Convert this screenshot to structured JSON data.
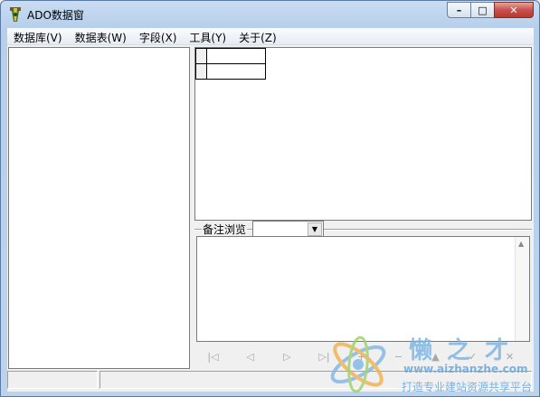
{
  "window": {
    "title": "ADO数据窗",
    "minimize_glyph": "–",
    "maximize_glyph": "□",
    "close_glyph": "✕"
  },
  "menu": {
    "items": [
      {
        "label": "数据库(V)"
      },
      {
        "label": "数据表(W)"
      },
      {
        "label": "字段(X)"
      },
      {
        "label": "工具(Y)"
      },
      {
        "label": "关于(Z)"
      }
    ]
  },
  "memo": {
    "label": "备注浏览",
    "selected_value": "",
    "dropdown_glyph": "▼",
    "scroll_up_glyph": "▲"
  },
  "navigator": {
    "buttons": [
      {
        "name": "first-record",
        "glyph": "|◁"
      },
      {
        "name": "prior-record",
        "glyph": "◁"
      },
      {
        "name": "next-record",
        "glyph": "▷"
      },
      {
        "name": "last-record",
        "glyph": "▷|"
      },
      {
        "name": "insert-record",
        "glyph": "+"
      },
      {
        "name": "delete-record",
        "glyph": "−"
      },
      {
        "name": "edit-record",
        "glyph": "▲"
      },
      {
        "name": "post-record",
        "glyph": "✓"
      },
      {
        "name": "cancel-record",
        "glyph": "✕"
      }
    ]
  },
  "watermark": {
    "site_name": "懒之才",
    "url": "www.aizhanzhe.com",
    "slogan": "打造专业建站资源共享平台"
  },
  "colors": {
    "titlebar": "#c9dcf2",
    "close_button": "#c75050",
    "watermark": "#6aa7dc"
  }
}
